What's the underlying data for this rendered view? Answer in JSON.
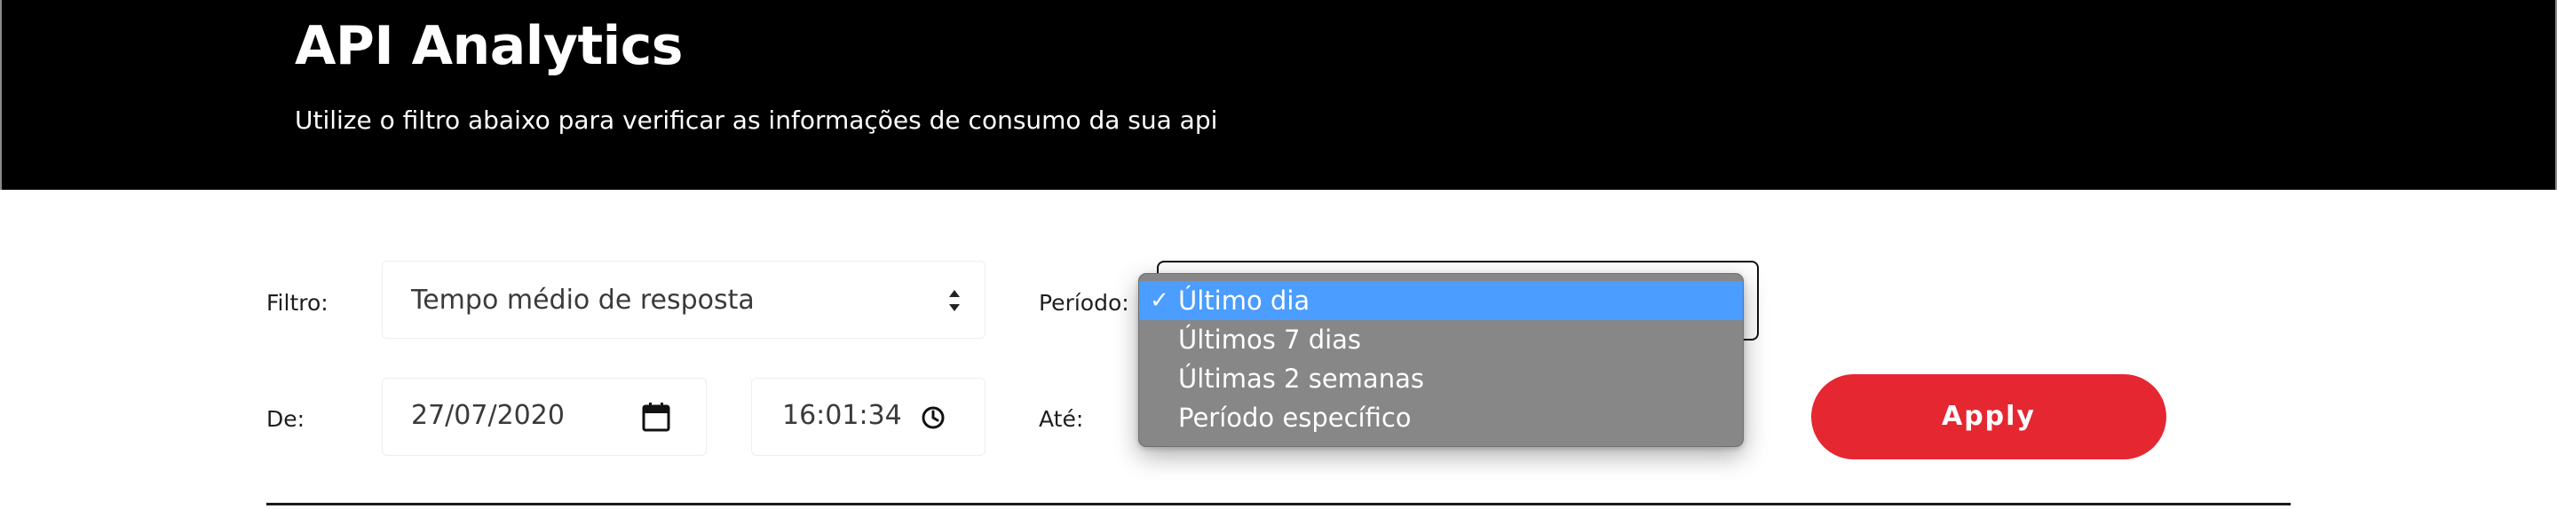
{
  "header": {
    "title": "API Analytics",
    "subtitle": "Utilize o filtro abaixo para verificar as informações de consumo da sua api"
  },
  "filter": {
    "label": "Filtro:",
    "value": "Tempo médio de resposta",
    "icon": "select-arrows-icon"
  },
  "period": {
    "label": "Período:",
    "options": [
      "Último dia",
      "Últimos 7 dias",
      "Últimas 2 semanas",
      "Período específico"
    ],
    "selected_index": 0,
    "check_mark": "✓"
  },
  "from": {
    "label": "De:",
    "date": "27/07/2020",
    "time": "16:01:34",
    "date_icon": "calendar-icon",
    "time_icon": "clock-icon"
  },
  "to": {
    "label": "Até:"
  },
  "apply": {
    "label": "Apply"
  },
  "colors": {
    "header_bg": "#000000",
    "apply_bg": "#e52731",
    "dropdown_bg": "#878787",
    "dropdown_selected": "#4b9dff"
  }
}
